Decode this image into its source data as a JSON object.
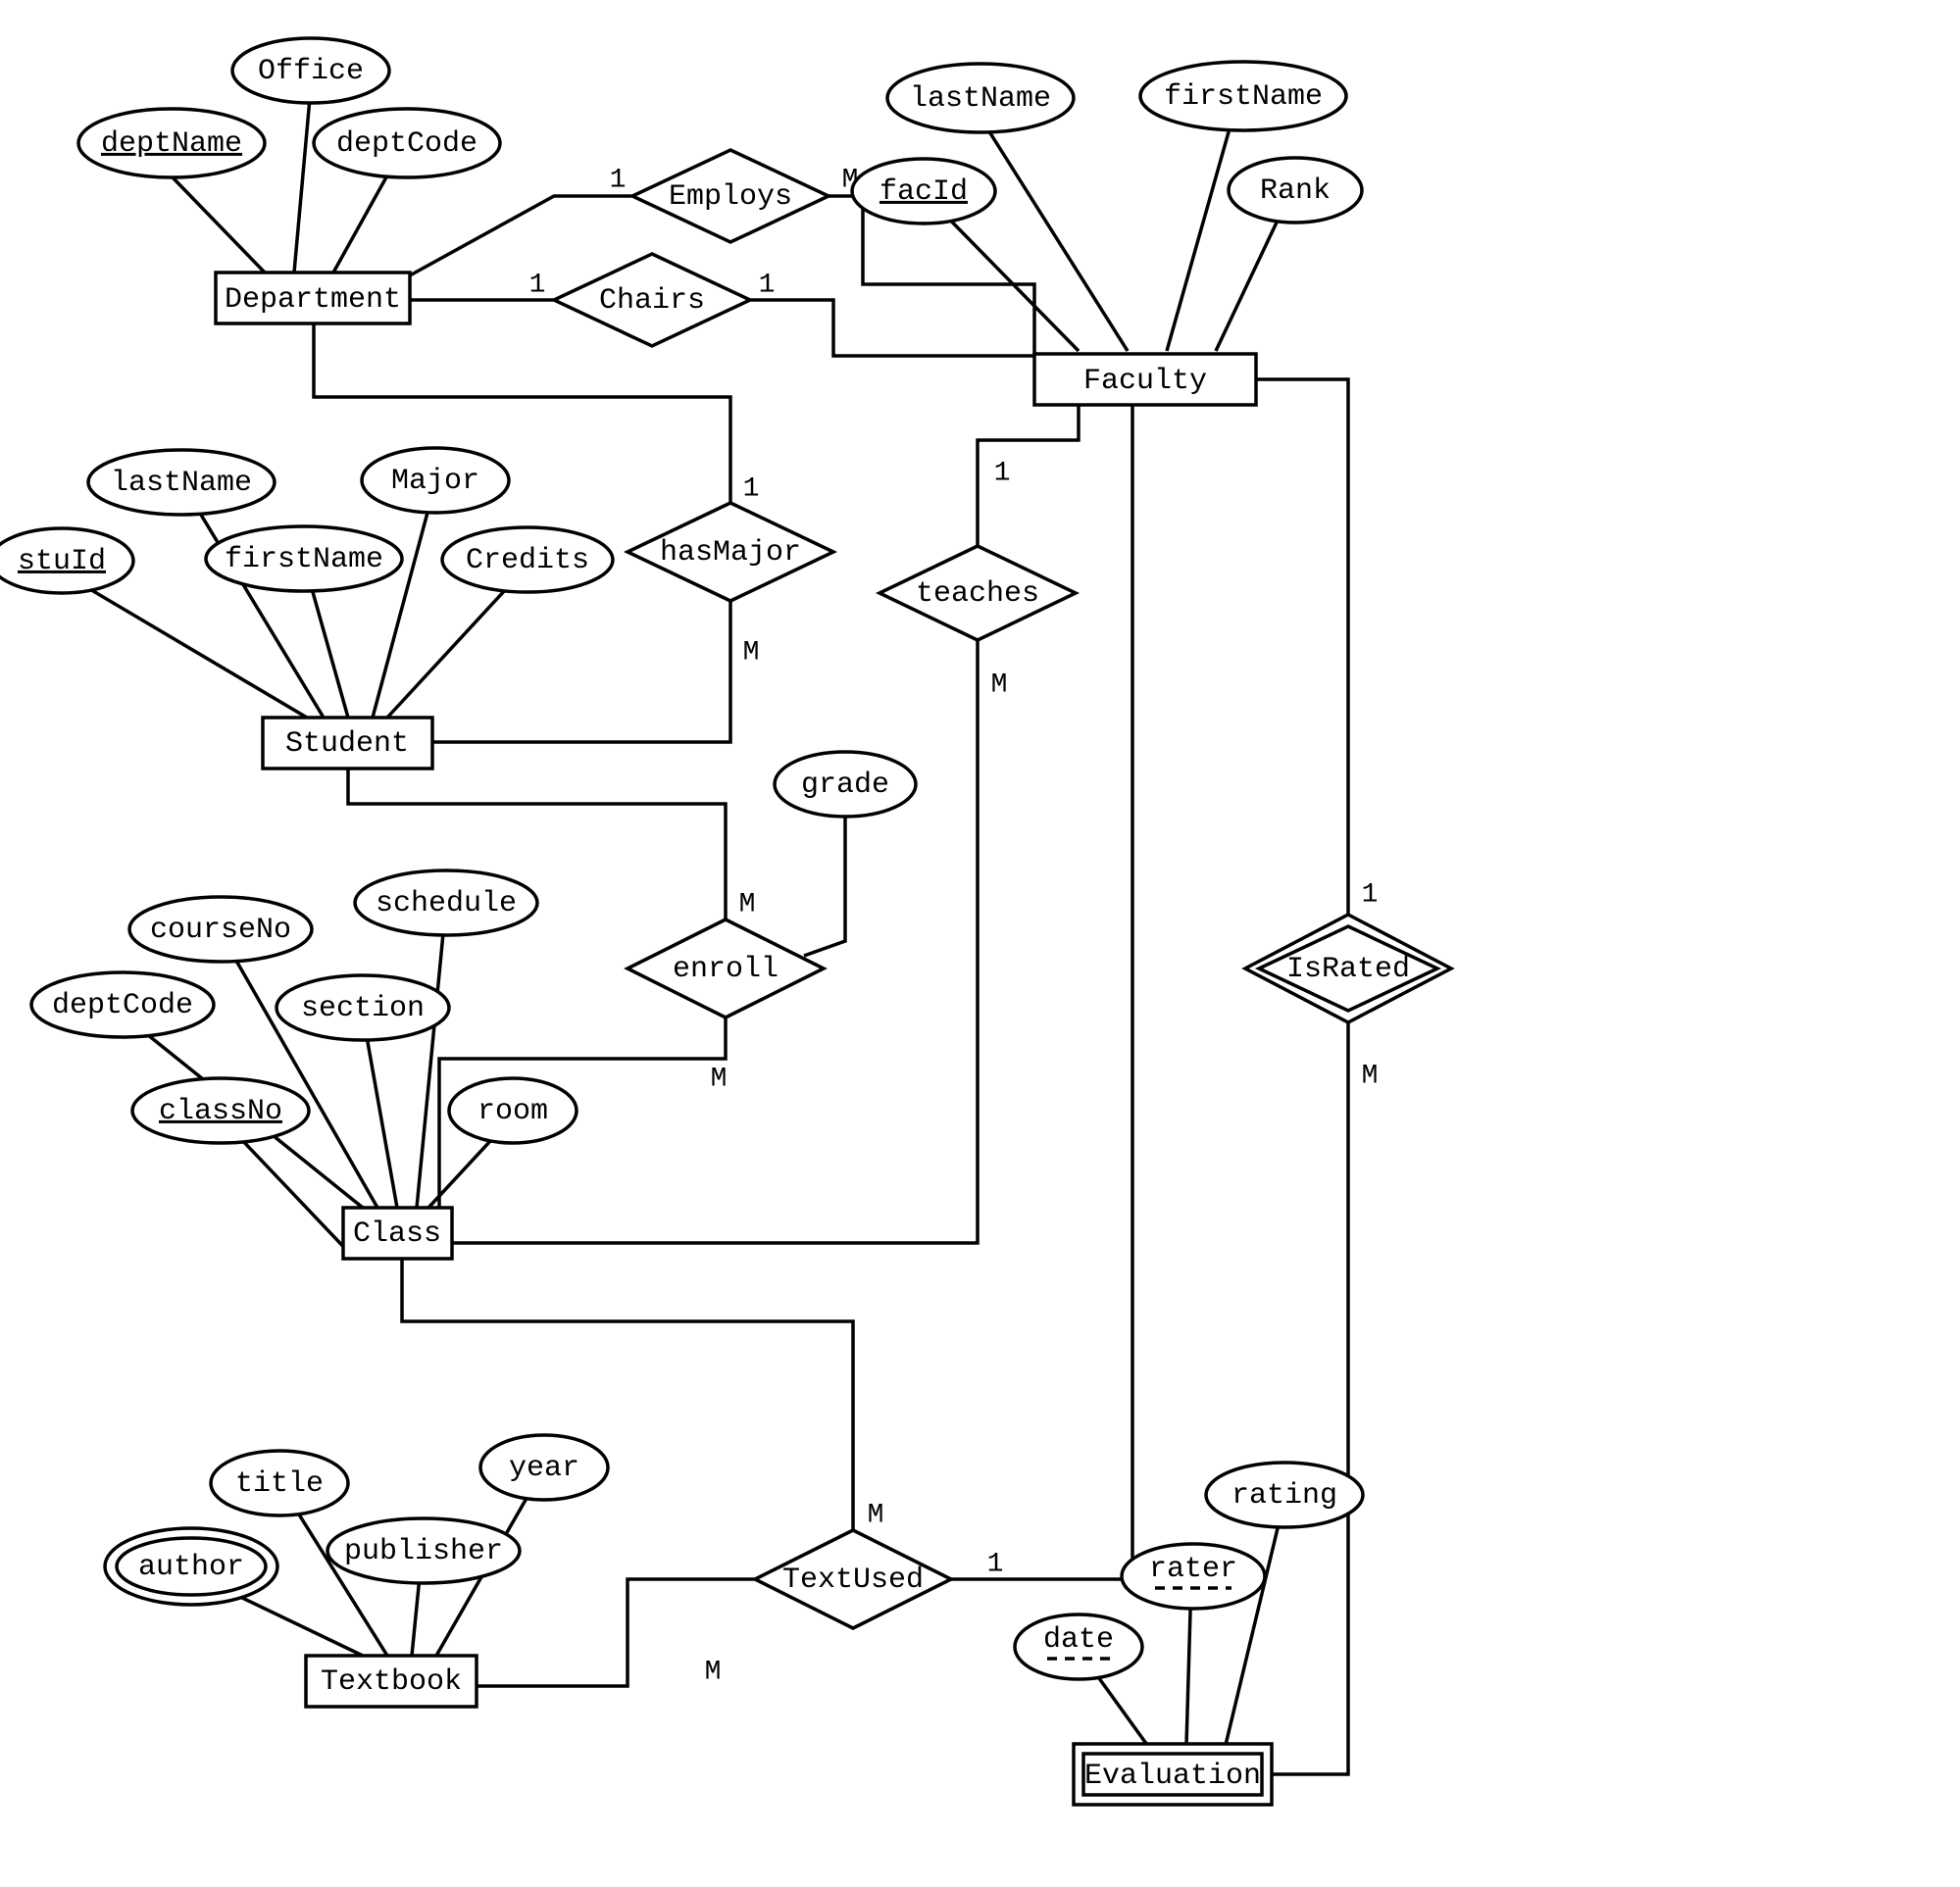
{
  "entities": {
    "department": "Department",
    "faculty": "Faculty",
    "student": "Student",
    "class": "Class",
    "textbook": "Textbook",
    "evaluation": "Evaluation"
  },
  "attributes": {
    "dept_deptName": "deptName",
    "dept_Office": "Office",
    "dept_deptCode": "deptCode",
    "fac_lastName": "lastName",
    "fac_firstName": "firstName",
    "fac_facId": "facId",
    "fac_Rank": "Rank",
    "stu_stuId": "stuId",
    "stu_lastName": "lastName",
    "stu_firstName": "firstName",
    "stu_Major": "Major",
    "stu_Credits": "Credits",
    "enroll_grade": "grade",
    "class_deptCode": "deptCode",
    "class_courseNo": "courseNo",
    "class_section": "section",
    "class_schedule": "schedule",
    "class_classNo": "classNo",
    "class_room": "room",
    "text_author": "author",
    "text_title": "title",
    "text_publisher": "publisher",
    "text_year": "year",
    "eval_date": "date",
    "eval_rater": "rater",
    "eval_rating": "rating"
  },
  "relationships": {
    "employs": "Employs",
    "chairs": "Chairs",
    "hasMajor": "hasMajor",
    "teaches": "teaches",
    "enroll": "enroll",
    "textUsed": "TextUsed",
    "isRated": "IsRated"
  },
  "cardinalities": {
    "employs_dept": "1",
    "employs_fac": "M",
    "chairs_dept": "1",
    "chairs_fac": "1",
    "hasMajor_dept": "1",
    "hasMajor_stu": "M",
    "teaches_fac": "1",
    "teaches_class": "M",
    "enroll_stu": "M",
    "enroll_class": "M",
    "textUsed_class": "M",
    "textUsed_text": "M",
    "textUsed_fac": "1",
    "isRated_fac": "1",
    "isRated_eval": "M"
  }
}
